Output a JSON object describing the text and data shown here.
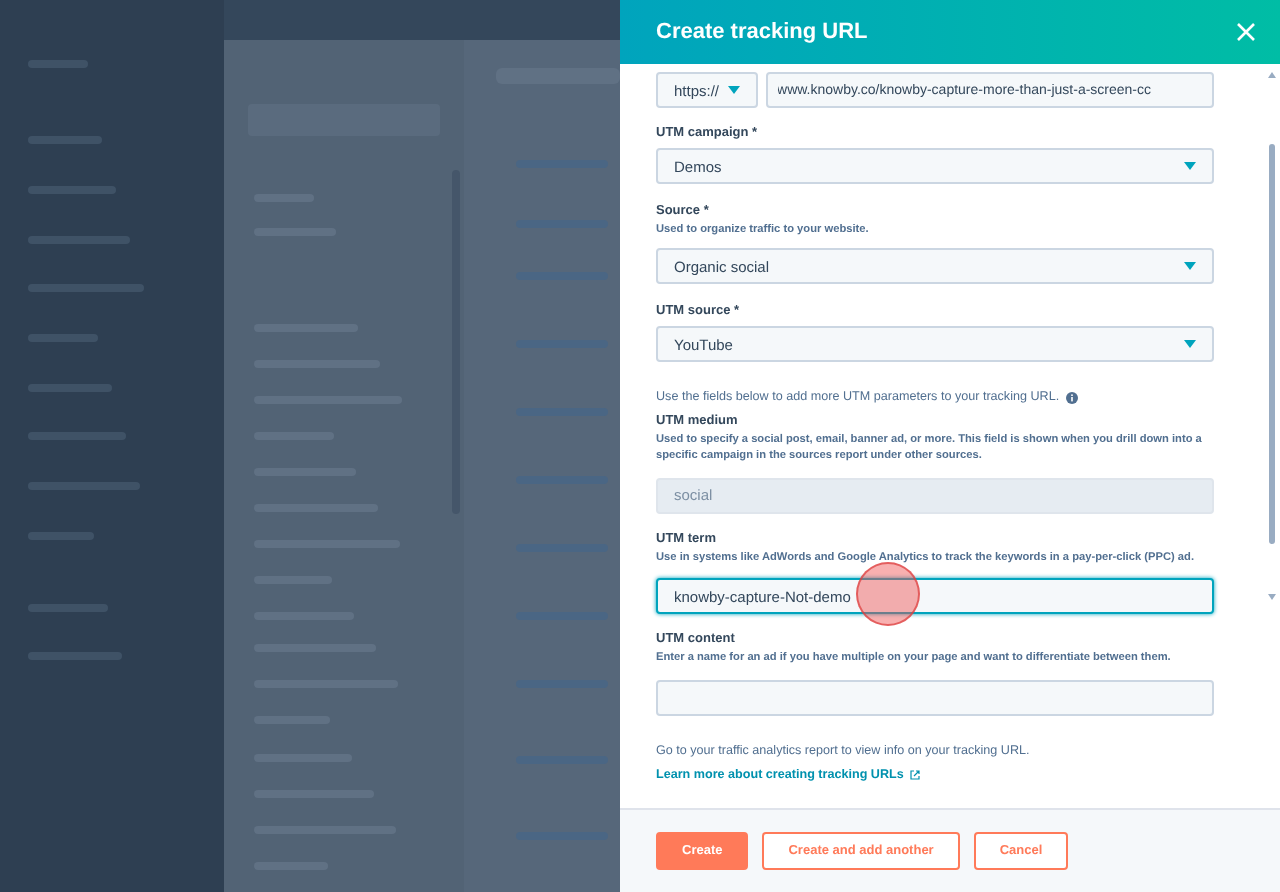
{
  "panel": {
    "title": "Create tracking URL"
  },
  "url_row": {
    "protocol": "https://",
    "url": "www.knowby.co/knowby-capture-more-than-just-a-screen-cc"
  },
  "fields": [
    {
      "kind": "select",
      "label": "UTM campaign *",
      "value": "Demos"
    },
    {
      "kind": "select",
      "label": "Source *",
      "help": "Used to organize traffic to your website.",
      "value": "Organic social"
    },
    {
      "kind": "select",
      "label": "UTM source *",
      "value": "YouTube"
    },
    {
      "kind": "note",
      "text": "Use the fields below to add more UTM parameters to your tracking URL."
    },
    {
      "kind": "text",
      "label": "UTM medium",
      "help": "Used to specify a social post, email, banner ad, or more. This field is shown when you drill down into a specific campaign in the sources report under other sources.",
      "value": "social",
      "disabled": true,
      "focused": false
    },
    {
      "kind": "text",
      "label": "UTM term",
      "help": "Use in systems like AdWords and Google Analytics to track the keywords in a pay-per-click (PPC) ad.",
      "value": "knowby-capture-Not-demo",
      "disabled": false,
      "focused": true
    },
    {
      "kind": "text",
      "label": "UTM content",
      "help": "Enter a name for an ad if you have multiple on your page and want to differentiate between them.",
      "disabled": false,
      "focused": false
    }
  ],
  "footer_text": "Go to your traffic analytics report to view info on your tracking URL.",
  "learn_link": "Learn more about creating tracking URLs",
  "buttons": [
    {
      "kind": "primary",
      "label": "Create"
    },
    {
      "kind": "secondary",
      "label": "Create and add another"
    },
    {
      "kind": "secondary",
      "label": "Cancel"
    }
  ]
}
